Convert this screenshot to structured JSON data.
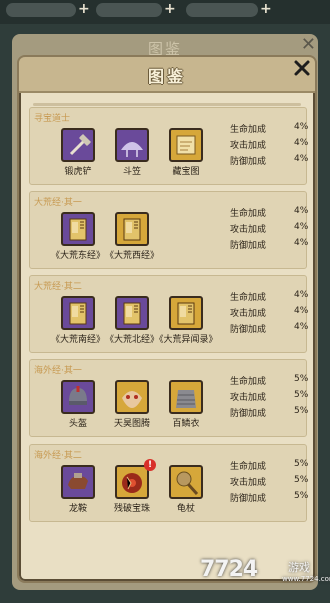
{
  "background": {
    "title": "图鉴",
    "plus": "+"
  },
  "panel": {
    "title": "图鉴",
    "close": "×"
  },
  "colors": {
    "section_title": "#c79a52",
    "panel_bg": "#e9dfc4",
    "purple_icon": "#6a4a9a",
    "gold_icon": "#d6a73a"
  },
  "sections": [
    {
      "title": "寻宝道士",
      "items": [
        {
          "name": "锻虎铲",
          "icon": "shovel-icon",
          "color": "purple"
        },
        {
          "name": "斗笠",
          "icon": "bamboo-hat-icon",
          "color": "purple"
        },
        {
          "name": "藏宝图",
          "icon": "treasure-map-icon",
          "color": "gold"
        }
      ],
      "stats": [
        {
          "label": "生命加成",
          "value": "4%"
        },
        {
          "label": "攻击加成",
          "value": "4%"
        },
        {
          "label": "防御加成",
          "value": "4%"
        }
      ]
    },
    {
      "title": "大荒经·其一",
      "items": [
        {
          "name": "《大荒东经》",
          "icon": "scroll-book-icon",
          "color": "purple"
        },
        {
          "name": "《大荒西经》",
          "icon": "scroll-book-icon",
          "color": "gold"
        }
      ],
      "stats": [
        {
          "label": "生命加成",
          "value": "4%"
        },
        {
          "label": "攻击加成",
          "value": "4%"
        },
        {
          "label": "防御加成",
          "value": "4%"
        }
      ]
    },
    {
      "title": "大荒经·其二",
      "items": [
        {
          "name": "《大荒南经》",
          "icon": "scroll-book-icon",
          "color": "purple"
        },
        {
          "name": "《大荒北经》",
          "icon": "scroll-book-icon",
          "color": "purple"
        },
        {
          "name": "《大荒异闻录》",
          "icon": "scroll-book-icon",
          "color": "gold"
        }
      ],
      "stats": [
        {
          "label": "生命加成",
          "value": "4%"
        },
        {
          "label": "攻击加成",
          "value": "4%"
        },
        {
          "label": "防御加成",
          "value": "4%"
        }
      ]
    },
    {
      "title": "海外经·其一",
      "items": [
        {
          "name": "头盔",
          "icon": "helmet-icon",
          "color": "purple"
        },
        {
          "name": "天昊图腾",
          "icon": "totem-icon",
          "color": "gold"
        },
        {
          "name": "百鳞衣",
          "icon": "scale-armor-icon",
          "color": "gold"
        }
      ],
      "stats": [
        {
          "label": "生命加成",
          "value": "5%"
        },
        {
          "label": "攻击加成",
          "value": "5%"
        },
        {
          "label": "防御加成",
          "value": "5%"
        }
      ]
    },
    {
      "title": "海外经·其二",
      "items": [
        {
          "name": "龙鞍",
          "icon": "dragon-saddle-icon",
          "color": "purple"
        },
        {
          "name": "残破宝珠",
          "icon": "broken-orb-icon",
          "color": "gold",
          "badge": "!"
        },
        {
          "name": "龟杖",
          "icon": "turtle-staff-icon",
          "color": "gold"
        }
      ],
      "stats": [
        {
          "label": "生命加成",
          "value": "5%"
        },
        {
          "label": "攻击加成",
          "value": "5%"
        },
        {
          "label": "防御加成",
          "value": "5%"
        }
      ]
    }
  ],
  "watermark": {
    "number": "7724",
    "text": "游戏",
    "url": "www.7724.com"
  }
}
